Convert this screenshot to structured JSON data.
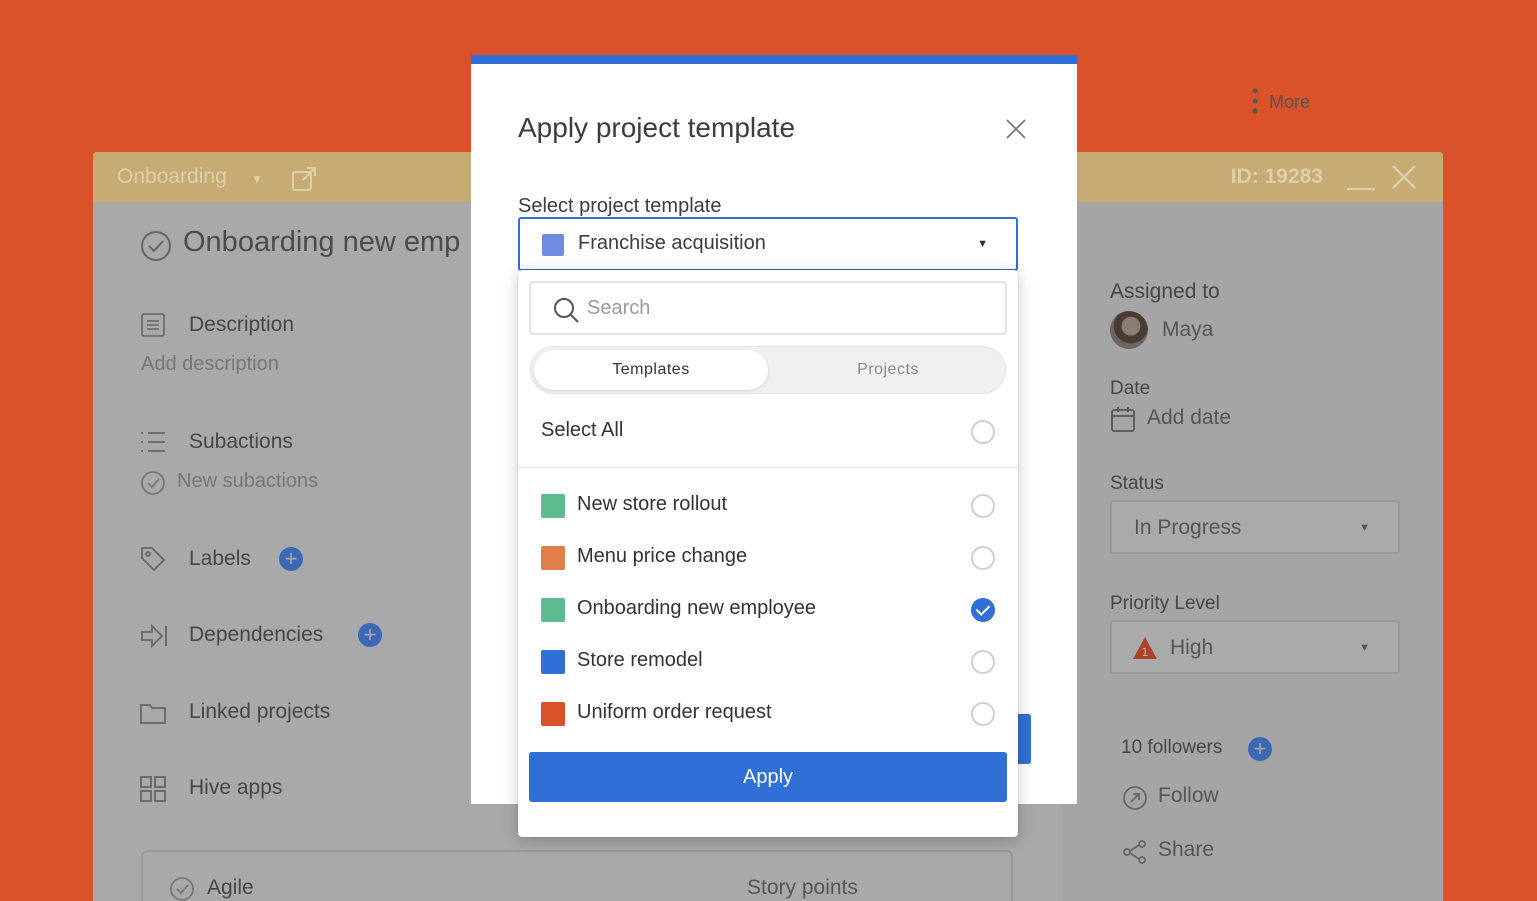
{
  "task_window": {
    "project_name": "Onboarding",
    "id_label": "ID: 19283",
    "title": "Onboarding new emp",
    "sections": {
      "description": "Description",
      "description_placeholder": "Add description",
      "subactions": "Subactions",
      "subactions_placeholder": "New subactions",
      "labels": "Labels",
      "dependencies": "Dependencies",
      "linked_projects": "Linked projects",
      "hive_apps": "Hive apps"
    },
    "agile": {
      "label": "Agile",
      "story_points": "Story points"
    },
    "right_panel": {
      "more": "More",
      "assigned_to_label": "Assigned to",
      "assignee": "Maya",
      "date_label": "Date",
      "date_value": "Add date",
      "status_label": "Status",
      "status_value": "In Progress",
      "priority_label": "Priority Level",
      "priority_value": "High",
      "followers": "10 followers",
      "follow": "Follow",
      "share": "Share"
    }
  },
  "modal": {
    "title": "Apply project template",
    "select_label": "Select project template",
    "selected_template": "Franchise acquisition",
    "selected_color": "#6f8ce0"
  },
  "dropdown": {
    "search_placeholder": "Search",
    "tabs": [
      {
        "label": "Templates",
        "active": true
      },
      {
        "label": "Projects",
        "active": false
      }
    ],
    "select_all": "Select All",
    "items": [
      {
        "name": "New store rollout",
        "color": "#5dbb8f",
        "checked": false
      },
      {
        "name": "Menu price change",
        "color": "#e07f4a",
        "checked": false
      },
      {
        "name": "Onboarding new employee",
        "color": "#5dbb8f",
        "checked": true
      },
      {
        "name": "Store remodel",
        "color": "#2f6fd6",
        "checked": false
      },
      {
        "name": "Uniform order request",
        "color": "#d9522a",
        "checked": false
      }
    ],
    "apply_label": "Apply"
  },
  "colors": {
    "background": "#d9522a",
    "accent": "#2f6fd6",
    "header": "#c6ab72"
  }
}
